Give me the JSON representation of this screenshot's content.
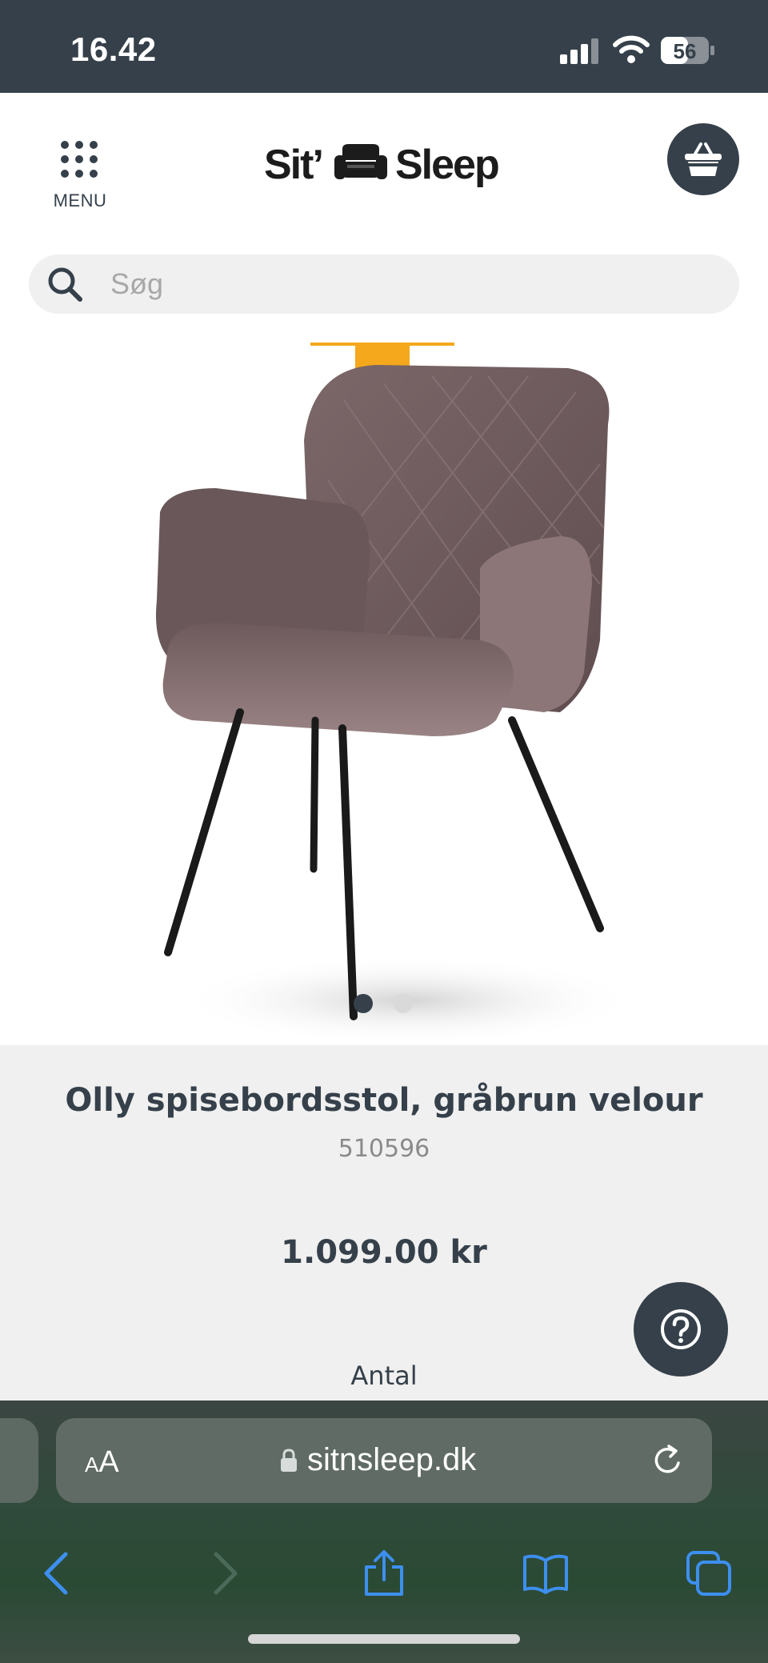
{
  "status_bar": {
    "time": "16.42",
    "battery_level": "56"
  },
  "header": {
    "menu_label": "MENU",
    "logo_word_1": "Sit’",
    "logo_word_2": "Sleep"
  },
  "search": {
    "placeholder": "Søg"
  },
  "gallery": {
    "image_count": 2,
    "active_index": 1
  },
  "product": {
    "title": "Olly spisebordsstol, gråbrun velour",
    "sku": "510596",
    "price": "1.099.00 kr",
    "quantity_label": "Antal"
  },
  "browser": {
    "text_size_small": "A",
    "text_size_big": "A",
    "url": "sitnsleep.dk"
  },
  "colors": {
    "brand_dark": "#35404a",
    "ribbon": "#f5a81c",
    "search_bg": "#f0f0f0",
    "info_bg": "#f0f0f0",
    "safari_blue": "#3d8ff0"
  }
}
